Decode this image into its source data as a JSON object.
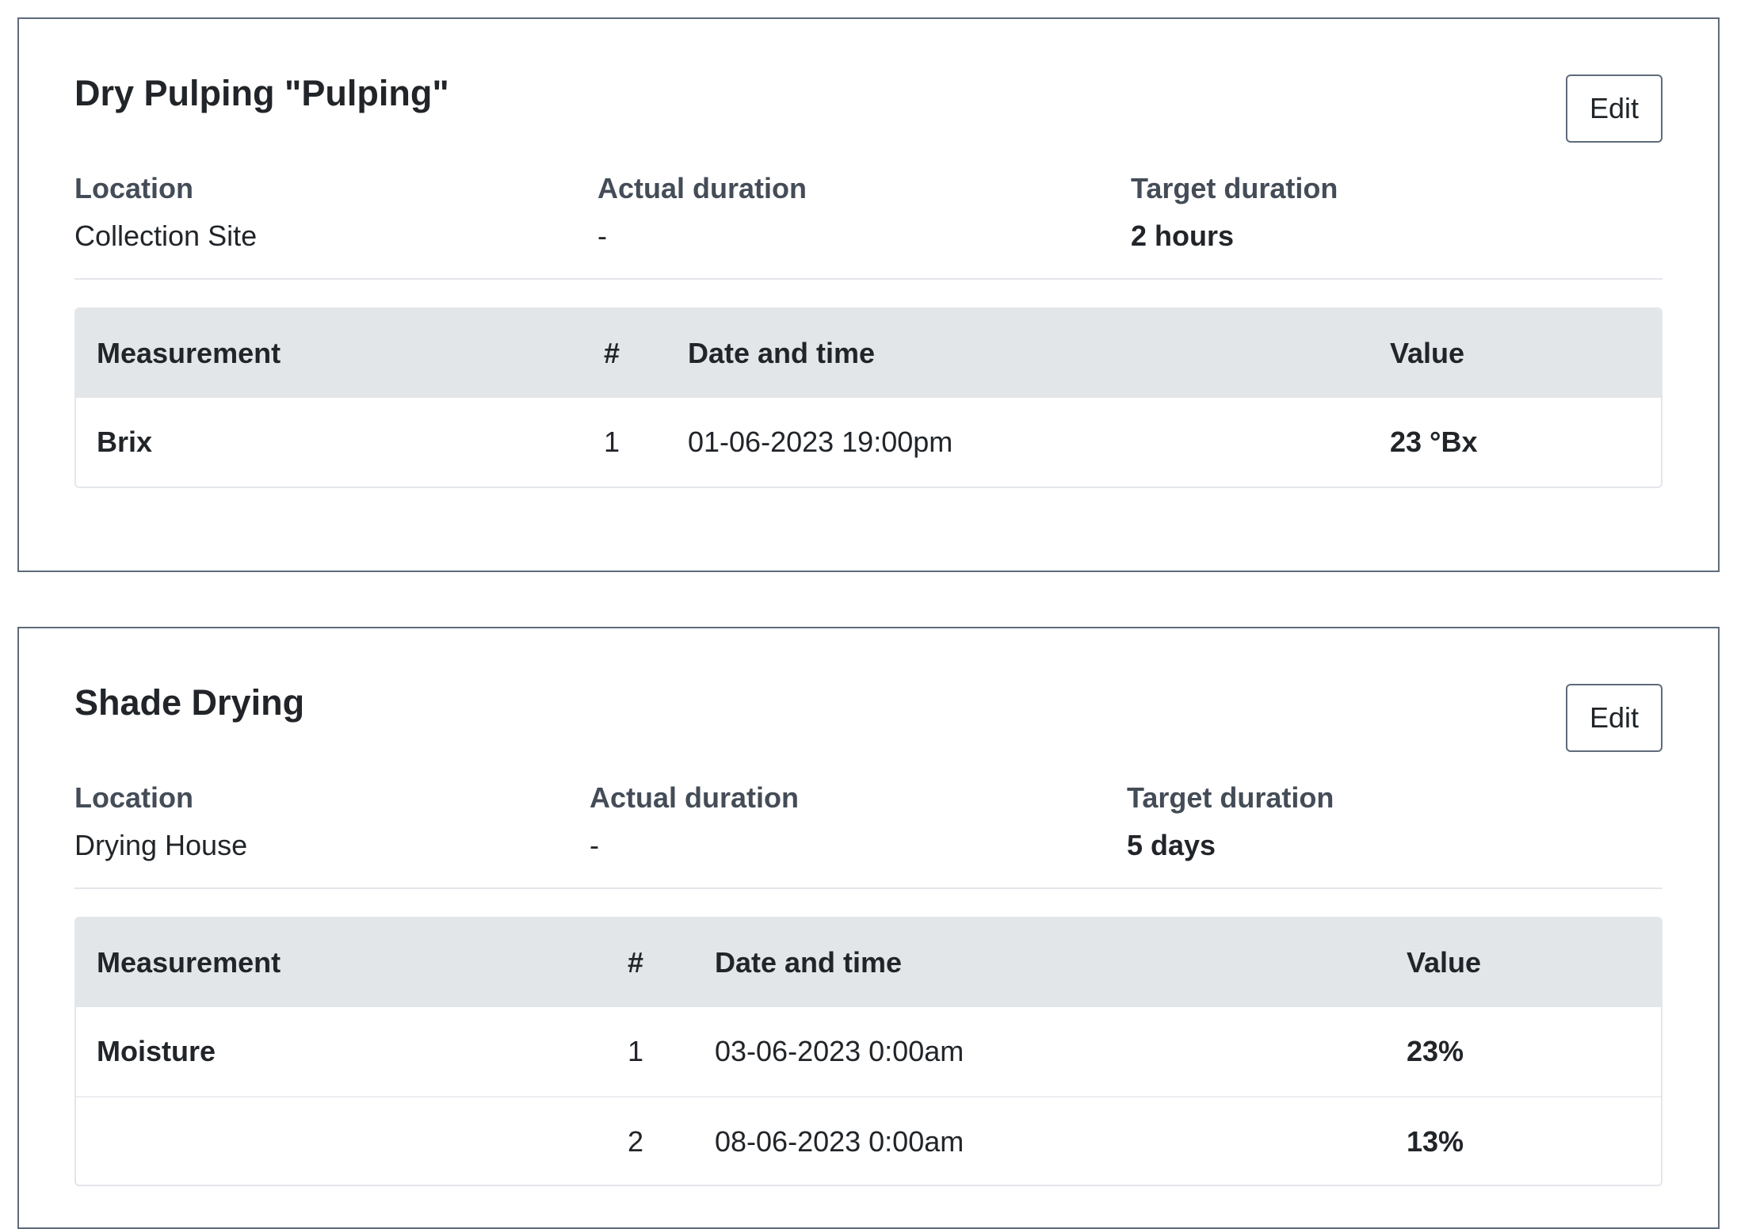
{
  "stages": [
    {
      "title": "Dry Pulping \"Pulping\"",
      "edit_label": "Edit",
      "info": {
        "location_label": "Location",
        "location_value": "Collection Site",
        "actual_label": "Actual duration",
        "actual_value": "-",
        "target_label": "Target duration",
        "target_value": "2 hours"
      },
      "table": {
        "headers": [
          "Measurement",
          "#",
          "Date and time",
          "Value"
        ],
        "rows": [
          {
            "measurement": "Brix",
            "num": "1",
            "datetime": "01-06-2023 19:00pm",
            "value": "23 °Bx"
          }
        ]
      }
    },
    {
      "title": "Shade Drying",
      "edit_label": "Edit",
      "info": {
        "location_label": "Location",
        "location_value": "Drying House",
        "actual_label": "Actual duration",
        "actual_value": "-",
        "target_label": "Target duration",
        "target_value": "5 days"
      },
      "table": {
        "headers": [
          "Measurement",
          "#",
          "Date and time",
          "Value"
        ],
        "rows": [
          {
            "measurement": "Moisture",
            "num": "1",
            "datetime": "03-06-2023 0:00am",
            "value": "23%"
          },
          {
            "measurement": "",
            "num": "2",
            "datetime": "08-06-2023 0:00am",
            "value": "13%"
          }
        ]
      }
    }
  ]
}
